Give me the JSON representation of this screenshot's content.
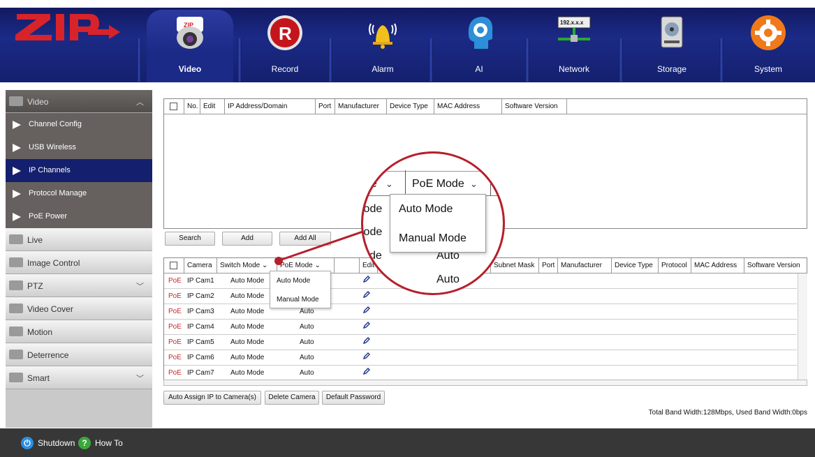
{
  "brand": "ZIP",
  "nav": {
    "tabs": [
      {
        "label": "Video",
        "icon": "camera-icon"
      },
      {
        "label": "Record",
        "icon": "record-icon"
      },
      {
        "label": "Alarm",
        "icon": "alarm-bell-icon"
      },
      {
        "label": "AI",
        "icon": "ai-head-icon"
      },
      {
        "label": "Network",
        "icon": "network-icon",
        "badge": "192.x.x.x"
      },
      {
        "label": "Storage",
        "icon": "hard-drive-icon"
      },
      {
        "label": "System",
        "icon": "gear-icon"
      }
    ]
  },
  "sidebar": {
    "groups": [
      {
        "label": "Video",
        "open": true,
        "icon": "video-icon"
      },
      {
        "label": "Live",
        "icon": "monitor-icon"
      },
      {
        "label": "Image Control",
        "icon": "image-icon"
      },
      {
        "label": "PTZ",
        "icon": "ptz-camera-icon"
      },
      {
        "label": "Video Cover",
        "icon": "video-cover-icon"
      },
      {
        "label": "Motion",
        "icon": "motion-icon"
      },
      {
        "label": "Deterrence",
        "icon": "deterrence-icon"
      },
      {
        "label": "Smart",
        "icon": "smart-icon"
      }
    ],
    "video_items": [
      "Channel Config",
      "USB Wireless",
      "IP Channels",
      "Protocol Manage",
      "PoE Power"
    ]
  },
  "search_table": {
    "headers": [
      "No.",
      "Edit",
      "IP Address/Domain",
      "Port",
      "Manufacturer",
      "Device Type",
      "MAC Address",
      "Software Version"
    ]
  },
  "actions": {
    "search": "Search",
    "add": "Add",
    "add_all": "Add All"
  },
  "camera_table": {
    "headers": [
      "Camera",
      "Switch Mode",
      "PoE Mode",
      "Edit",
      "Subnet Mask",
      "Port",
      "Manufacturer",
      "Device Type",
      "Protocol",
      "MAC Address",
      "Software Version"
    ],
    "rows": [
      {
        "poe": "PoE",
        "camera": "IP Cam1",
        "switch_mode": "Auto Mode",
        "poe_mode": ""
      },
      {
        "poe": "PoE",
        "camera": "IP Cam2",
        "switch_mode": "Auto Mode",
        "poe_mode": ""
      },
      {
        "poe": "PoE",
        "camera": "IP Cam3",
        "switch_mode": "Auto Mode",
        "poe_mode": "Auto"
      },
      {
        "poe": "PoE",
        "camera": "IP Cam4",
        "switch_mode": "Auto Mode",
        "poe_mode": "Auto"
      },
      {
        "poe": "PoE",
        "camera": "IP Cam5",
        "switch_mode": "Auto Mode",
        "poe_mode": "Auto"
      },
      {
        "poe": "PoE",
        "camera": "IP Cam6",
        "switch_mode": "Auto Mode",
        "poe_mode": "Auto"
      },
      {
        "poe": "PoE",
        "camera": "IP Cam7",
        "switch_mode": "Auto Mode",
        "poe_mode": "Auto"
      }
    ]
  },
  "poe_dropdown": {
    "options": [
      "Auto Mode",
      "Manual Mode"
    ]
  },
  "zoom": {
    "col_left": "de",
    "header": "PoE Mode",
    "cells_left": [
      "lode",
      "lode",
      "de"
    ],
    "options": [
      "Auto Mode",
      "Manual Mode"
    ],
    "values_right": [
      "Auto",
      "Auto"
    ]
  },
  "bottom_buttons": {
    "auto_assign": "Auto Assign IP to Camera(s)",
    "delete": "Delete Camera",
    "default_password": "Default Password"
  },
  "bandwidth": "Total Band Width:128Mbps, Used Band Width:0bps",
  "footer": {
    "shutdown": "Shutdown",
    "howto": "How To"
  }
}
